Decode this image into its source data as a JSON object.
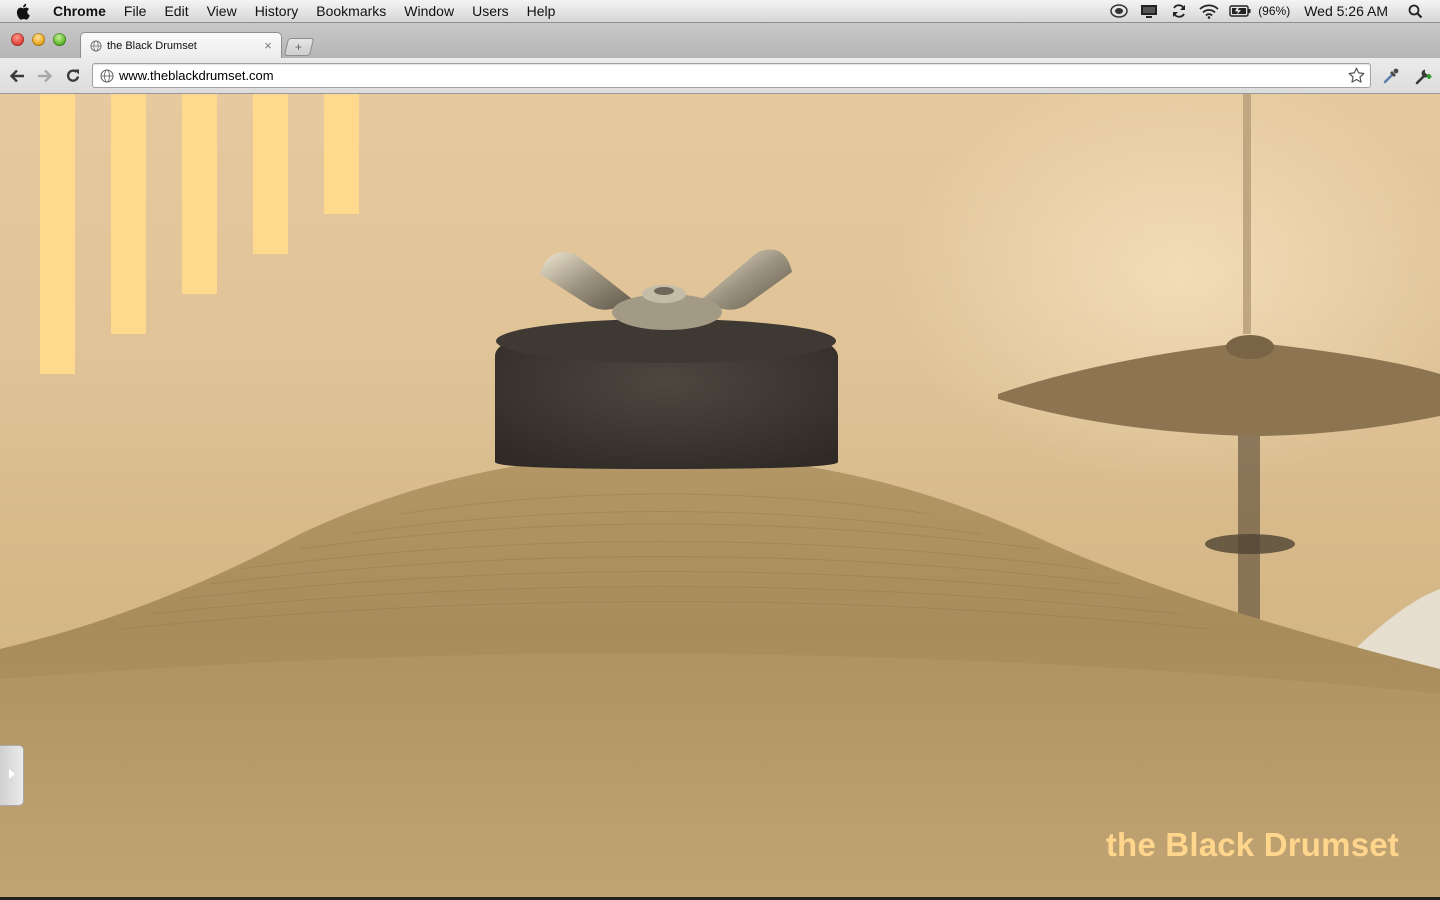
{
  "menubar": {
    "apple_icon": "apple-logo-icon",
    "app_name": "Chrome",
    "items": [
      "File",
      "Edit",
      "View",
      "History",
      "Bookmarks",
      "Window",
      "Users",
      "Help"
    ],
    "status_icons": [
      "time-machine-icon",
      "display-icon",
      "sync-icon",
      "wifi-icon",
      "battery-icon"
    ],
    "battery_percent": "(96%)",
    "clock": "Wed 5:26 AM",
    "spotlight_icon": "spotlight-search-icon"
  },
  "browser": {
    "tab": {
      "title": "the Black Drumset",
      "favicon": "globe-icon",
      "close": "×"
    },
    "new_tab": "+",
    "url": "www.theblackdrumset.com"
  },
  "page": {
    "site_title": "the Black Drumset",
    "equalizer_levels": [
      280,
      240,
      200,
      160,
      120
    ],
    "accent_color": "#ffd98c",
    "background_color": "#dcc193",
    "side_toggle_icon": "chevron-right-icon"
  }
}
